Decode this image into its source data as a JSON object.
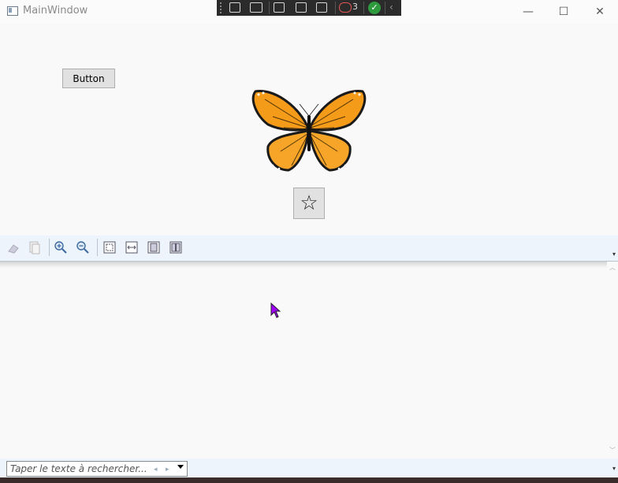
{
  "window": {
    "title": "MainWindow",
    "minimize_glyph": "—",
    "maximize_glyph": "☐",
    "close_glyph": "✕"
  },
  "devtools": {
    "count": "3"
  },
  "main": {
    "button_label": "Button",
    "star_glyph": "☆"
  },
  "toolbar": {
    "icons": [
      "copy-icon",
      "paste-icon",
      "zoom-in-icon",
      "zoom-out-icon",
      "actual-size-icon",
      "fit-width-icon",
      "single-page-icon",
      "two-pages-icon"
    ]
  },
  "findbar": {
    "placeholder": "Taper le texte à rechercher...",
    "prev": "◂",
    "next": "▸"
  },
  "colors": {
    "accent": "#2b579a",
    "cursor": "#a100ff",
    "butterfly_orange": "#f59b1a"
  }
}
